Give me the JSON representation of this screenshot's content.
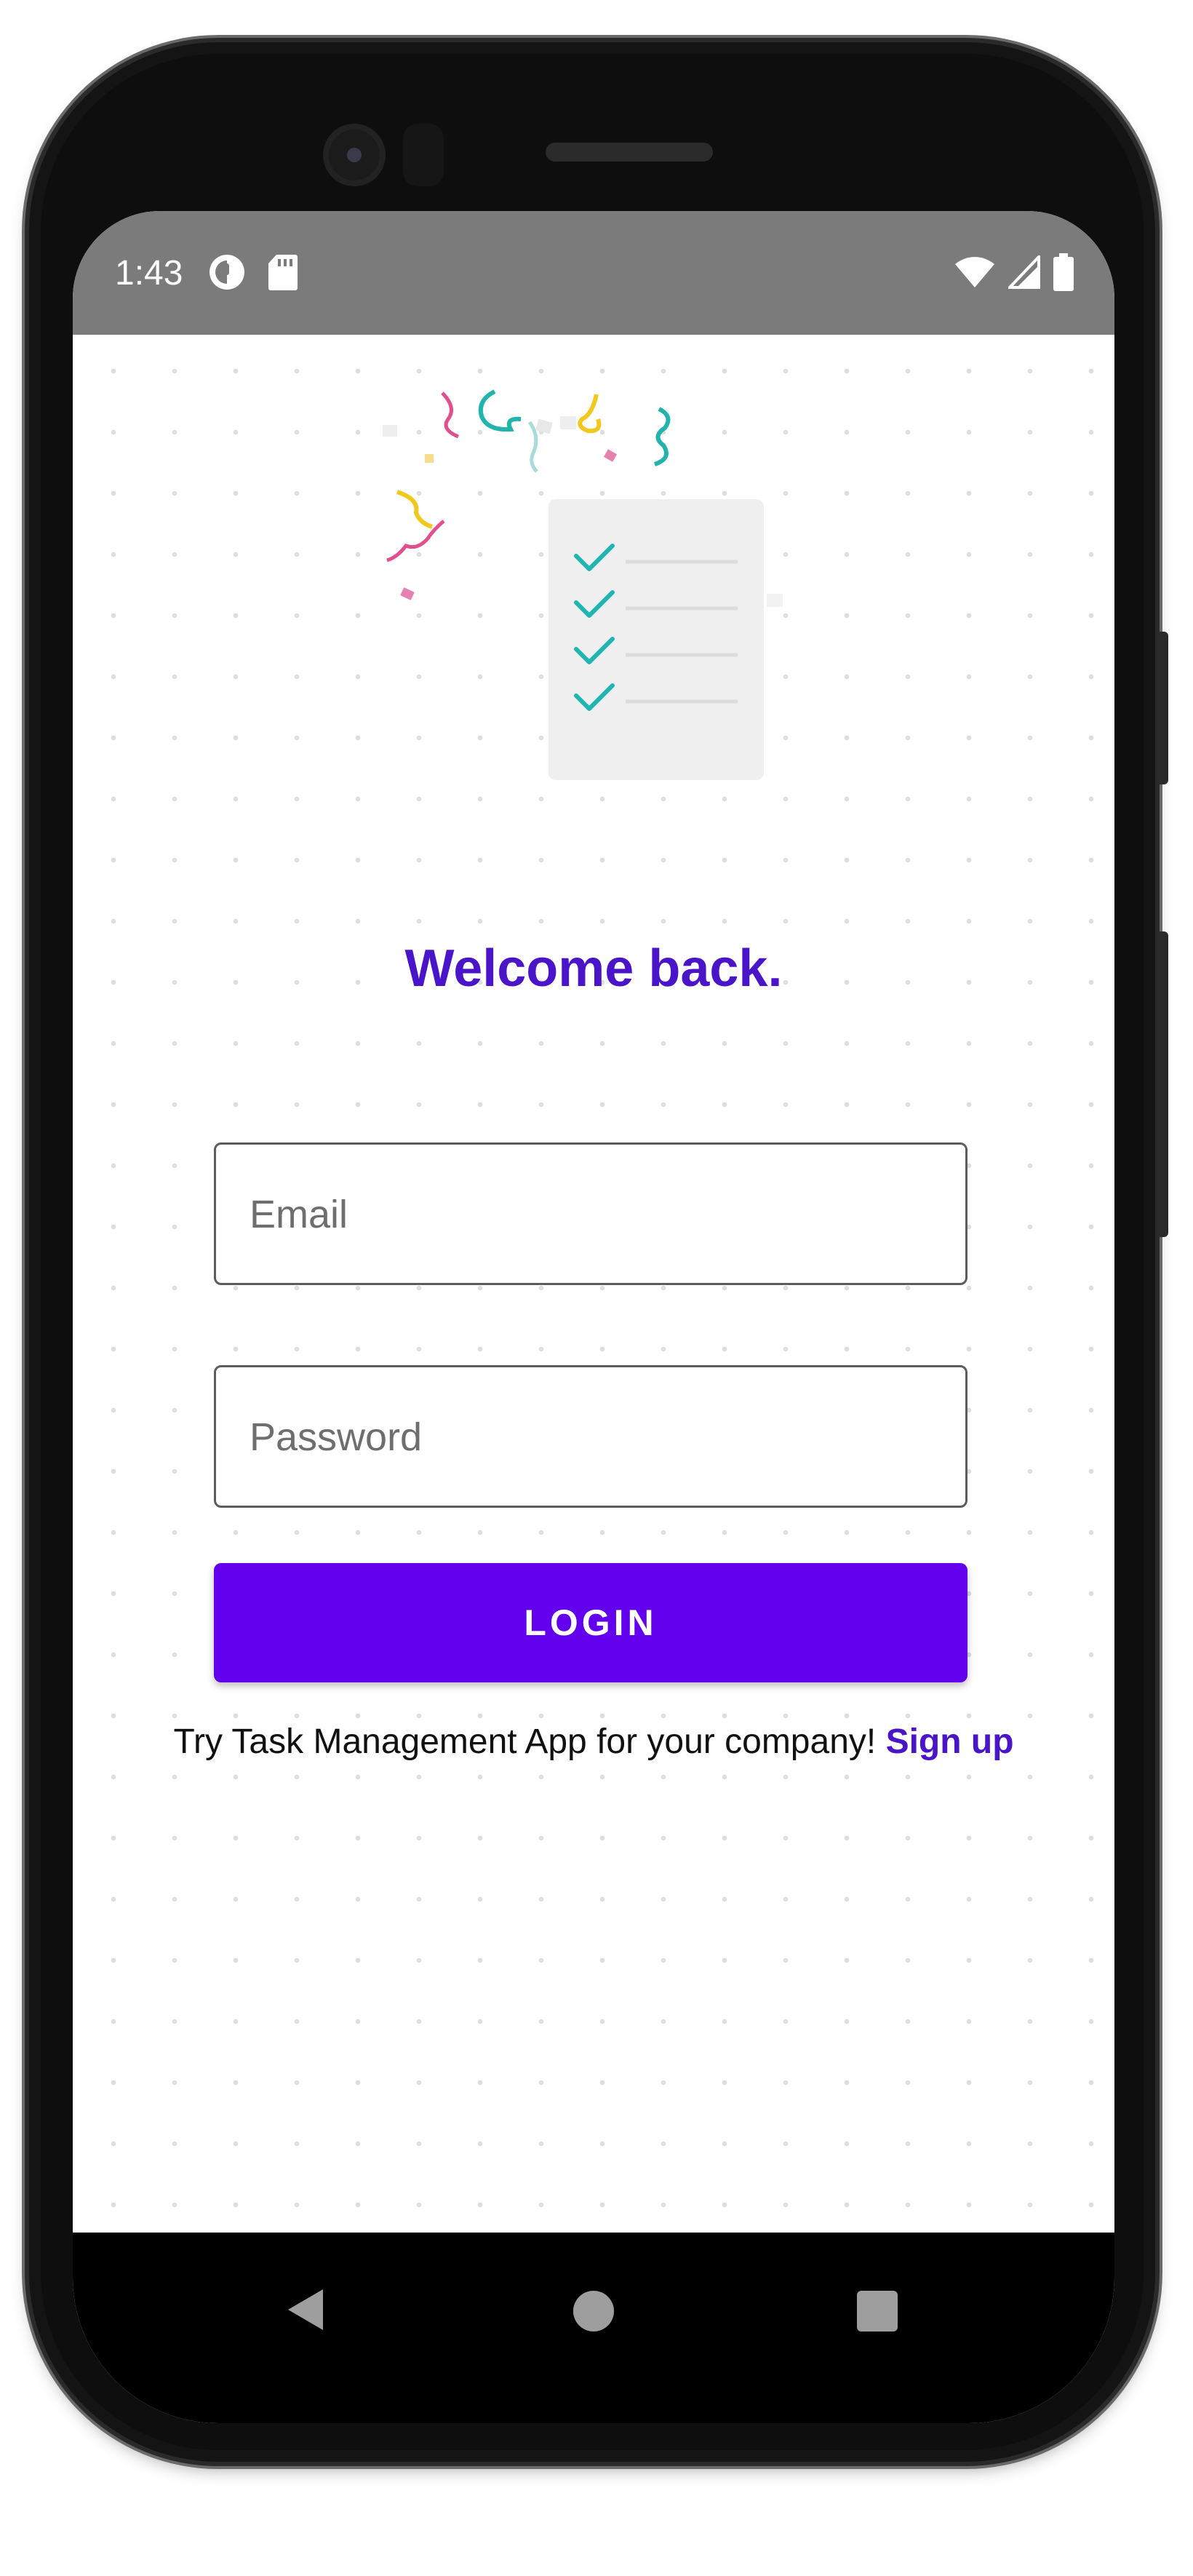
{
  "status_bar": {
    "time": "1:43",
    "icons_left": [
      "app-notification-icon",
      "sd-card-icon"
    ],
    "icons_right": [
      "wifi-icon",
      "cellular-signal-icon",
      "battery-icon"
    ]
  },
  "login": {
    "title": "Welcome back.",
    "email_placeholder": "Email",
    "email_value": "",
    "password_placeholder": "Password",
    "password_value": "",
    "login_button": "LOGIN",
    "signup_prompt": "Try Task Management App for your company!",
    "signup_link": "Sign up"
  },
  "nav_bar": {
    "icons": [
      "back-icon",
      "home-icon",
      "recent-apps-icon"
    ]
  },
  "colors": {
    "accent": "#6200ee",
    "title": "#4a14c8",
    "status_bar": "#7b7b7b",
    "checkmark": "#1fb5b0"
  }
}
